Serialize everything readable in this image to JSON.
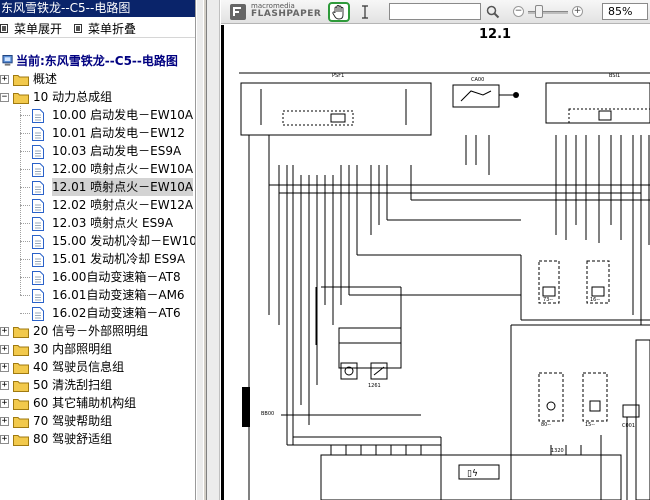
{
  "window": {
    "title": "东风雪铁龙--C5--电路图"
  },
  "nav_toolbar": {
    "expand_label": "菜单展开",
    "collapse_label": "菜单折叠"
  },
  "tree": {
    "root_label": "当前:东风雪铁龙--C5--电路图",
    "items": [
      {
        "label": "概述",
        "type": "folder",
        "level": 1,
        "expanded": false
      },
      {
        "label": "10 动力总成组",
        "type": "folder",
        "level": 1,
        "expanded": true
      },
      {
        "label": "10.00 启动发电－EW10A",
        "type": "doc",
        "level": 2
      },
      {
        "label": "10.01 启动发电－EW12",
        "type": "doc",
        "level": 2
      },
      {
        "label": "10.03 启动发电－ES9A",
        "type": "doc",
        "level": 2
      },
      {
        "label": "12.00 喷射点火－EW10A",
        "type": "doc",
        "level": 2
      },
      {
        "label": "12.01 喷射点火－EW10A",
        "type": "doc",
        "level": 2,
        "selected": true
      },
      {
        "label": "12.02 喷射点火－EW12A",
        "type": "doc",
        "level": 2
      },
      {
        "label": "12.03 喷射点火  ES9A",
        "type": "doc",
        "level": 2
      },
      {
        "label": "15.00 发动机冷却－EW10",
        "type": "doc",
        "level": 2
      },
      {
        "label": "15.01 发动机冷却  ES9A",
        "type": "doc",
        "level": 2
      },
      {
        "label": "16.00自动变速箱－AT8",
        "type": "doc",
        "level": 2
      },
      {
        "label": "16.01自动变速箱－AM6",
        "type": "doc",
        "level": 2
      },
      {
        "label": "16.02自动变速箱－AT6",
        "type": "doc",
        "level": 2
      },
      {
        "label": "20 信号－外部照明组",
        "type": "folder",
        "level": 1,
        "expanded": false
      },
      {
        "label": "30 内部照明组",
        "type": "folder",
        "level": 1,
        "expanded": false
      },
      {
        "label": "40 驾驶员信息组",
        "type": "folder",
        "level": 1,
        "expanded": false
      },
      {
        "label": "50 清洗刮扫组",
        "type": "folder",
        "level": 1,
        "expanded": false
      },
      {
        "label": "60 其它辅助机构组",
        "type": "folder",
        "level": 1,
        "expanded": false
      },
      {
        "label": "70 驾驶帮助组",
        "type": "folder",
        "level": 1,
        "expanded": false
      },
      {
        "label": "80 驾驶舒适组",
        "type": "folder",
        "level": 1,
        "expanded": false
      }
    ]
  },
  "viewer": {
    "brand_small": "macromedia",
    "brand_big": "FLASHPAPER",
    "search_value": "",
    "zoom": "85%",
    "page_number": "12.1"
  },
  "schematic": {
    "labels": [
      "PSF1",
      "CA00",
      "BSI1",
      "BB00",
      "C001",
      "1261",
      "1320",
      "73--",
      "16--",
      "80--",
      "15--"
    ]
  },
  "colors": {
    "title_bar": "#0a246a",
    "selection": "#d3d3d3",
    "folder": "#f2c94c",
    "doc_icon": "#2a62c9",
    "active_tool": "#2e9a3a"
  }
}
